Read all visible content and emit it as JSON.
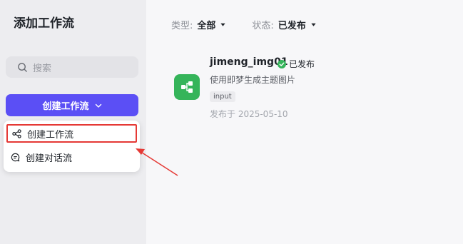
{
  "sidebar": {
    "title": "添加工作流",
    "search_placeholder": "搜索",
    "create_button_label": "创建工作流",
    "dropdown": [
      {
        "label": "创建工作流",
        "icon": "workflow-icon"
      },
      {
        "label": "创建对话流",
        "icon": "chat-icon"
      }
    ]
  },
  "filters": {
    "type_label": "类型:",
    "type_value": "全部",
    "status_label": "状态:",
    "status_value": "已发布"
  },
  "workflow_card": {
    "name": "jimeng_img01",
    "status": "已发布",
    "description": "使用即梦生成主题图片",
    "tag": "input",
    "published": "发布于 2025-05-10"
  },
  "colors": {
    "accent": "#5b4ff5",
    "success": "#35b45a",
    "highlight": "#e53935"
  }
}
